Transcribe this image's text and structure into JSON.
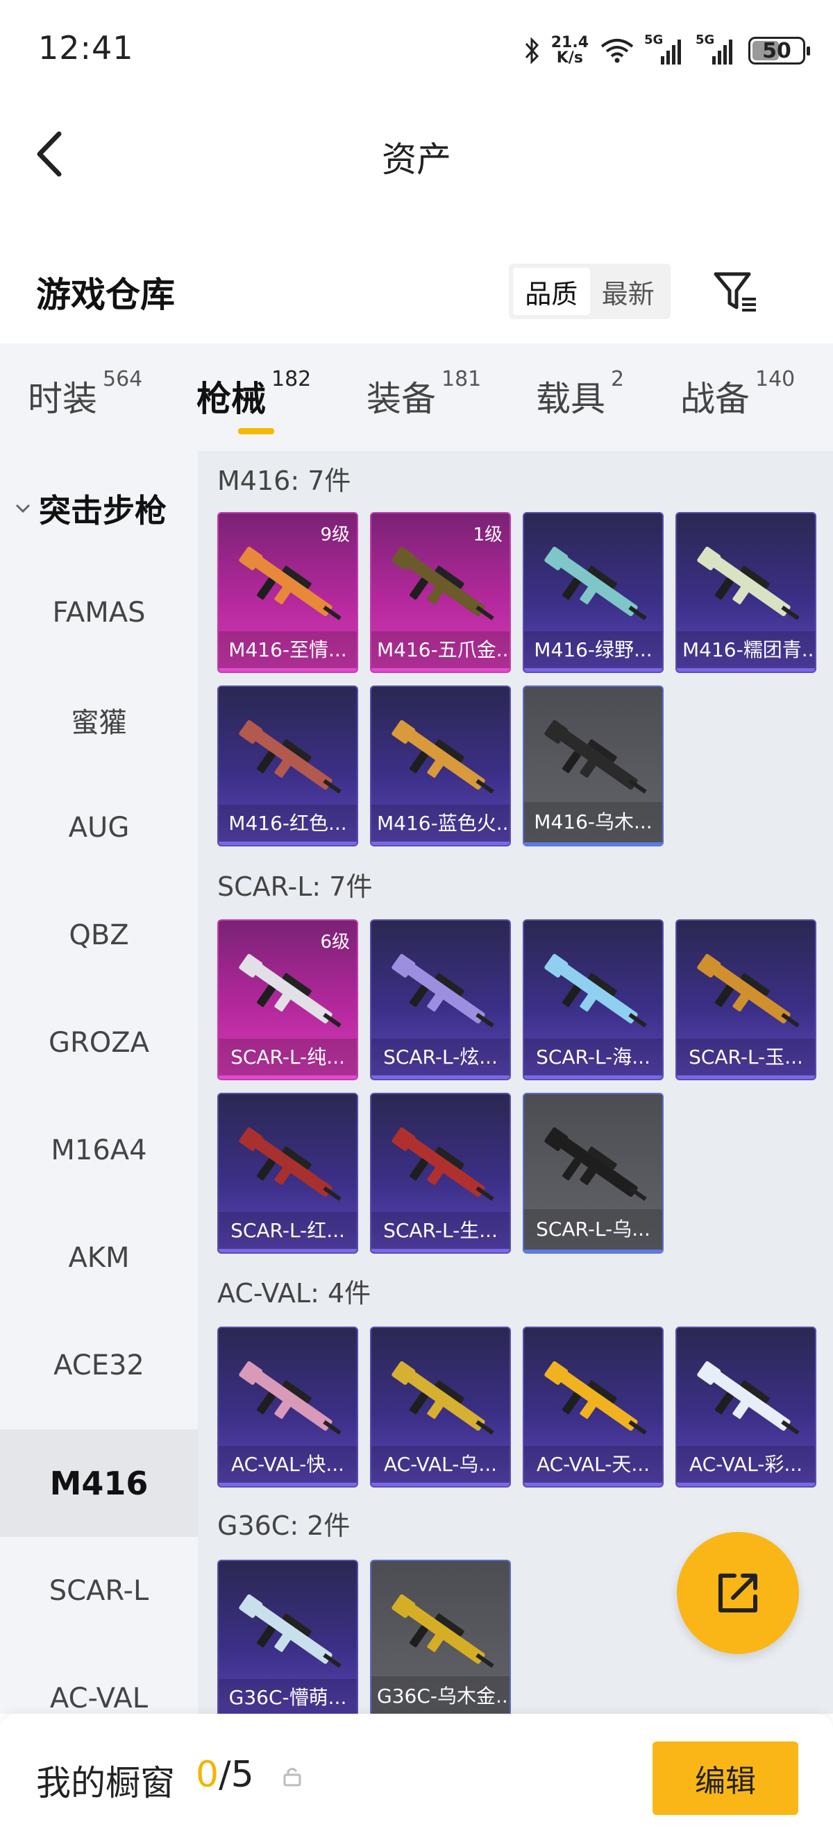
{
  "status": {
    "time": "12:41",
    "net_speed_value": "21.4",
    "net_speed_unit": "K/s",
    "signal1_label": "5G",
    "signal2_label": "5G",
    "battery": "50"
  },
  "header": {
    "title": "资产"
  },
  "warehouse": {
    "title": "游戏仓库",
    "sort_options": [
      "品质",
      "最新"
    ],
    "sort_active": "品质"
  },
  "tabs": [
    {
      "label": "时装",
      "count": "564"
    },
    {
      "label": "枪械",
      "count": "182"
    },
    {
      "label": "装备",
      "count": "181"
    },
    {
      "label": "载具",
      "count": "2"
    },
    {
      "label": "战备",
      "count": "140"
    }
  ],
  "sidebar": {
    "group": "突击步枪",
    "items": [
      "FAMAS",
      "蜜獾",
      "AUG",
      "QBZ",
      "GROZA",
      "M16A4",
      "AKM",
      "ACE32",
      "M416",
      "SCAR-L",
      "AC-VAL"
    ],
    "active": "M416"
  },
  "sections": [
    {
      "title": "M416: 7件",
      "items": [
        {
          "name": "M416-至情...",
          "level": "9级",
          "rarity": "legend",
          "tint": "#e8893a"
        },
        {
          "name": "M416-五爪金...",
          "level": "1级",
          "rarity": "legend",
          "tint": "#6b5a2a"
        },
        {
          "name": "M416-绿野...",
          "level": "",
          "rarity": "purple",
          "tint": "#7fc6c9"
        },
        {
          "name": "M416-糯团青...",
          "level": "",
          "rarity": "purple",
          "tint": "#d9e3c4"
        },
        {
          "name": "M416-红色...",
          "level": "",
          "rarity": "purple",
          "tint": "#b35a4f"
        },
        {
          "name": "M416-蓝色火...",
          "level": "",
          "rarity": "purple",
          "tint": "#d89a3a"
        },
        {
          "name": "M416-乌木...",
          "level": "",
          "rarity": "grey",
          "tint": "#2a2a2a"
        }
      ]
    },
    {
      "title": "SCAR-L: 7件",
      "items": [
        {
          "name": "SCAR-L-纯...",
          "level": "6级",
          "rarity": "legend",
          "tint": "#e0e0e6"
        },
        {
          "name": "SCAR-L-炫...",
          "level": "",
          "rarity": "purple",
          "tint": "#9c8fe0"
        },
        {
          "name": "SCAR-L-海...",
          "level": "",
          "rarity": "purple",
          "tint": "#8fd0f0"
        },
        {
          "name": "SCAR-L-玉...",
          "level": "",
          "rarity": "purple",
          "tint": "#d0902e"
        },
        {
          "name": "SCAR-L-红...",
          "level": "",
          "rarity": "purple",
          "tint": "#a8302e"
        },
        {
          "name": "SCAR-L-生...",
          "level": "",
          "rarity": "purple",
          "tint": "#b0302e"
        },
        {
          "name": "SCAR-L-乌...",
          "level": "",
          "rarity": "grey",
          "tint": "#1e1e1e"
        }
      ]
    },
    {
      "title": "AC-VAL: 4件",
      "items": [
        {
          "name": "AC-VAL-快...",
          "level": "",
          "rarity": "purple",
          "tint": "#d89ab8"
        },
        {
          "name": "AC-VAL-乌...",
          "level": "",
          "rarity": "purple",
          "tint": "#d6b030"
        },
        {
          "name": "AC-VAL-天...",
          "level": "",
          "rarity": "purple",
          "tint": "#f0b21e"
        },
        {
          "name": "AC-VAL-彩...",
          "level": "",
          "rarity": "purple",
          "tint": "#e8eef8"
        }
      ]
    },
    {
      "title": "G36C: 2件",
      "items": [
        {
          "name": "G36C-懵萌...",
          "level": "",
          "rarity": "purple",
          "tint": "#c8e0ec"
        },
        {
          "name": "G36C-乌木金...",
          "level": "",
          "rarity": "grey",
          "tint": "#d6ae26"
        }
      ]
    }
  ],
  "bottom": {
    "showcase_label": "我的橱窗",
    "showcase_used": "0",
    "showcase_total": "/5",
    "edit_label": "编辑"
  },
  "colors": {
    "accent": "#f9b616",
    "legend": "#c53cb0",
    "epic": "#5a4db0",
    "grey": "#5a5b60"
  }
}
